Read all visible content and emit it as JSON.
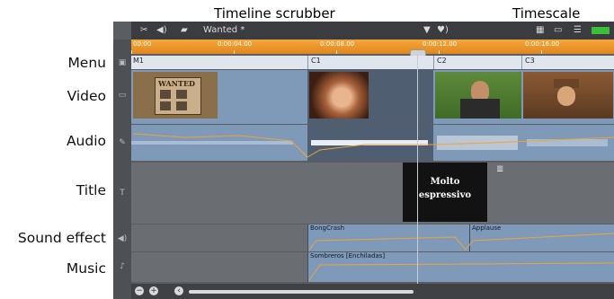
{
  "callouts": {
    "timeline_scrubber": "Timeline scrubber",
    "timescale": "Timescale"
  },
  "side_labels": {
    "menu": "Menu",
    "video": "Video",
    "audio": "Audio",
    "title": "Title",
    "sound_effect": "Sound effect",
    "music": "Music"
  },
  "toolbar": {
    "project_name": "Wanted *"
  },
  "timescale": {
    "ticks": [
      "00:00",
      "0:00:04.00",
      "0:00:08.00",
      "0:00:12.00",
      "0:00:16.00"
    ]
  },
  "menu_track": {
    "markers": [
      "M1",
      "C1",
      "C2",
      "C3"
    ]
  },
  "title_track": {
    "clip_lines": [
      "Molto",
      "espressivo"
    ]
  },
  "sound_effect_track": {
    "clips": [
      "BongCrash",
      "Applause"
    ]
  },
  "music_track": {
    "clips": [
      "Sombreros [Enchiladas]"
    ]
  },
  "poster": {
    "text": "WANTED"
  },
  "colors": {
    "timescale_orange": "#e8911f",
    "clip_blue": "#7f9ab8",
    "volume_line": "#f0a23a"
  }
}
